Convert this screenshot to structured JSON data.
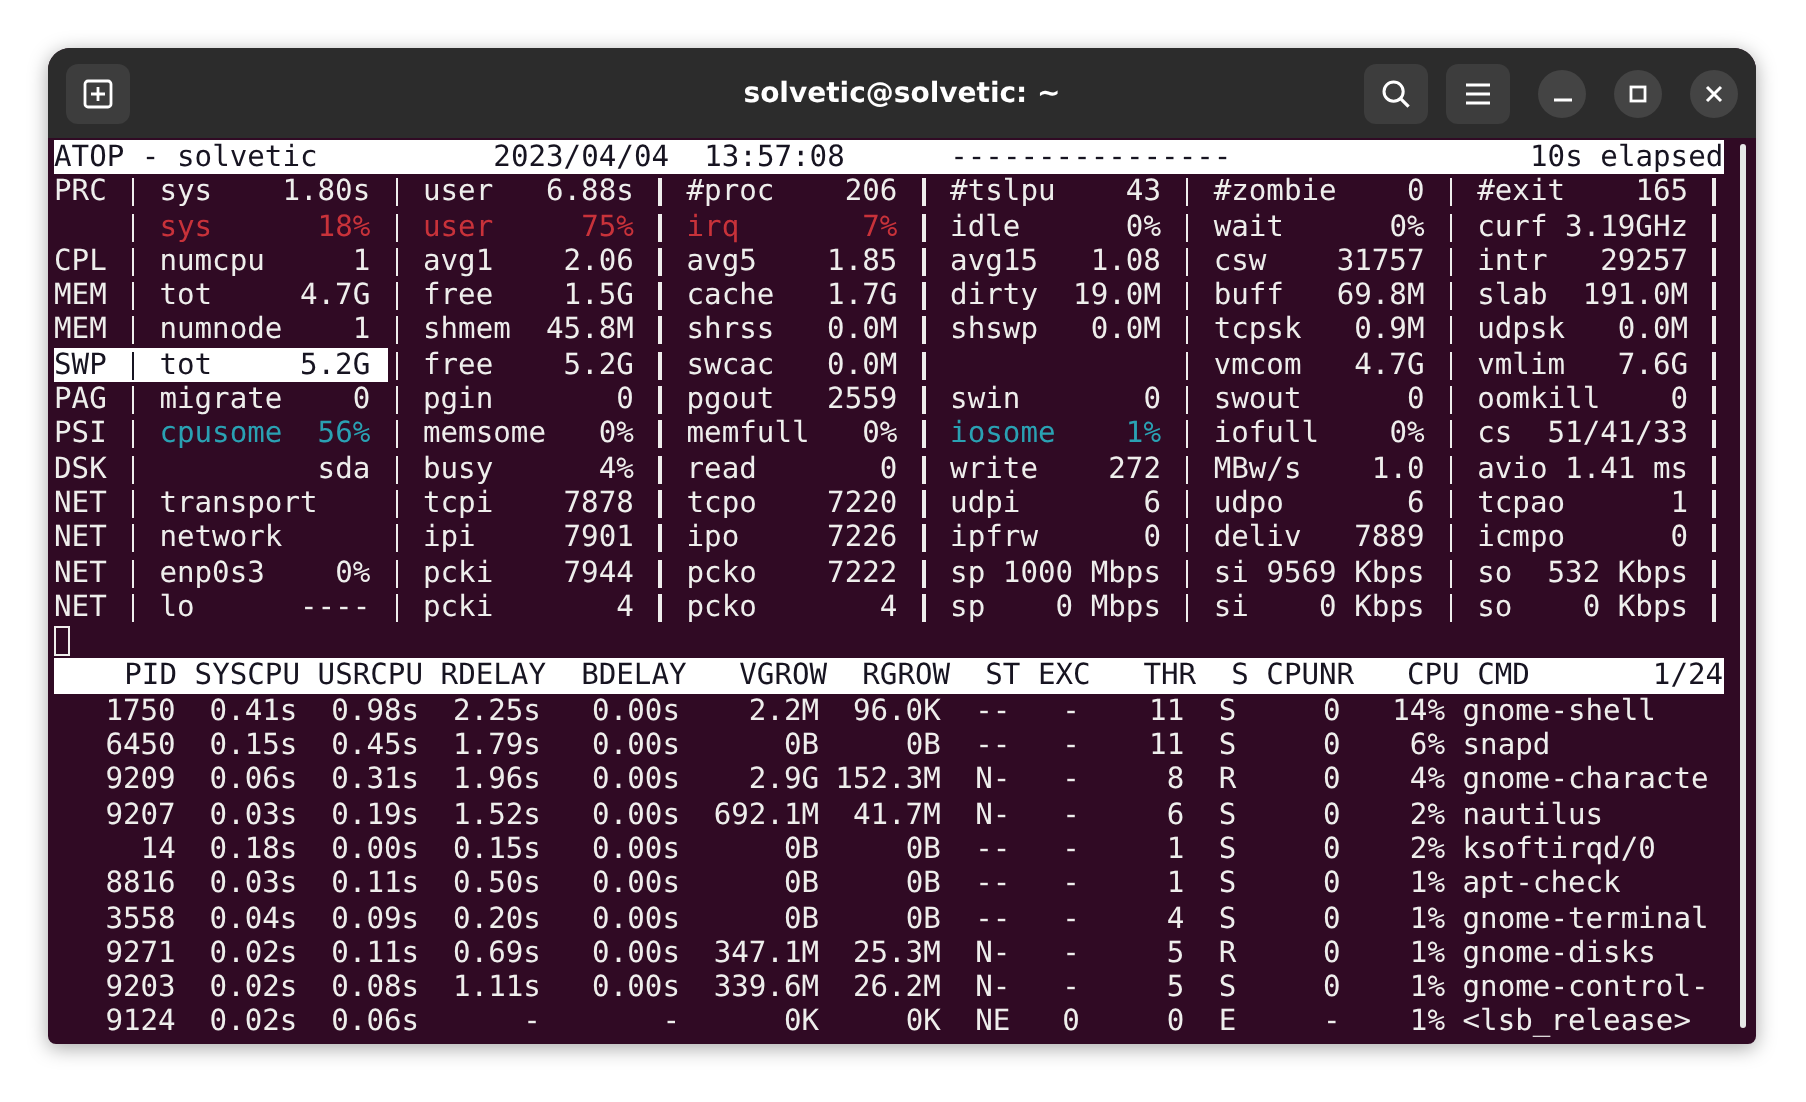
{
  "window": {
    "title": "solvetic@solvetic: ~"
  },
  "header": {
    "host": "ATOP - solvetic",
    "date": "2023/04/04",
    "time": "13:57:08",
    "dashes": "----------------",
    "elapsed": "10s elapsed"
  },
  "system_lines": [
    {
      "label": "PRC",
      "highlighted": false,
      "cells": [
        {
          "kind": "stat",
          "name": "sys",
          "value": "1.80s"
        },
        {
          "kind": "stat",
          "name": "user",
          "value": "6.88s"
        },
        {
          "kind": "stat",
          "name": "#proc",
          "value": "206"
        },
        {
          "kind": "stat",
          "name": "#tslpu",
          "value": "43"
        },
        {
          "kind": "stat",
          "name": "#zombie",
          "value": "0"
        },
        {
          "kind": "stat",
          "name": "#exit",
          "value": "165"
        }
      ]
    },
    {
      "highlighted": false,
      "cells": [
        {
          "kind": "stat",
          "name": "sys",
          "value": "18%",
          "color": "#c8323a"
        },
        {
          "kind": "stat",
          "name": "user",
          "value": "75%",
          "color": "#c8323a"
        },
        {
          "kind": "stat",
          "name": "irq",
          "value": "7%",
          "color": "#c8323a"
        },
        {
          "kind": "stat",
          "name": "idle",
          "value": "0%"
        },
        {
          "kind": "stat",
          "name": "wait",
          "value": "0%"
        },
        {
          "kind": "stat",
          "name": "curf",
          "value": "3.19GHz"
        }
      ]
    },
    {
      "label": "CPL",
      "highlighted": false,
      "cells": [
        {
          "kind": "stat",
          "name": "numcpu",
          "value": "1"
        },
        {
          "kind": "stat",
          "name": "avg1",
          "value": "2.06"
        },
        {
          "kind": "stat",
          "name": "avg5",
          "value": "1.85"
        },
        {
          "kind": "stat",
          "name": "avg15",
          "value": "1.08"
        },
        {
          "kind": "stat",
          "name": "csw",
          "value": "31757"
        },
        {
          "kind": "stat",
          "name": "intr",
          "value": "29257"
        }
      ]
    },
    {
      "label": "MEM",
      "highlighted": false,
      "cells": [
        {
          "kind": "stat",
          "name": "tot",
          "value": "4.7G"
        },
        {
          "kind": "stat",
          "name": "free",
          "value": "1.5G"
        },
        {
          "kind": "stat",
          "name": "cache",
          "value": "1.7G"
        },
        {
          "kind": "stat",
          "name": "dirty",
          "value": "19.0M"
        },
        {
          "kind": "stat",
          "name": "buff",
          "value": "69.8M"
        },
        {
          "kind": "stat",
          "name": "slab",
          "value": "191.0M"
        }
      ]
    },
    {
      "label": "MEM",
      "highlighted": false,
      "cells": [
        {
          "kind": "stat",
          "name": "numnode",
          "value": "1"
        },
        {
          "kind": "stat",
          "name": "shmem",
          "value": "45.8M"
        },
        {
          "kind": "stat",
          "name": "shrss",
          "value": "0.0M"
        },
        {
          "kind": "stat",
          "name": "shswp",
          "value": "0.0M"
        },
        {
          "kind": "stat",
          "name": "tcpsk",
          "value": "0.9M"
        },
        {
          "kind": "stat",
          "name": "udpsk",
          "value": "0.0M"
        }
      ]
    },
    {
      "label": "SWP",
      "highlighted": true,
      "cells": [
        {
          "kind": "stat",
          "name": "tot",
          "value": "5.2G"
        },
        {
          "kind": "stat",
          "name": "free",
          "value": "5.2G"
        },
        {
          "kind": "stat",
          "name": "swcac",
          "value": "0.0M"
        },
        {
          "kind": "blank"
        },
        {
          "kind": "stat",
          "name": "vmcom",
          "value": "4.7G"
        },
        {
          "kind": "stat",
          "name": "vmlim",
          "value": "7.6G"
        }
      ]
    },
    {
      "label": "PAG",
      "highlighted": false,
      "cells": [
        {
          "kind": "stat",
          "name": "migrate",
          "value": "0"
        },
        {
          "kind": "stat",
          "name": "pgin",
          "value": "0"
        },
        {
          "kind": "stat",
          "name": "pgout",
          "value": "2559"
        },
        {
          "kind": "stat",
          "name": "swin",
          "value": "0"
        },
        {
          "kind": "stat",
          "name": "swout",
          "value": "0"
        },
        {
          "kind": "stat",
          "name": "oomkill",
          "value": "0"
        }
      ]
    },
    {
      "label": "PSI",
      "highlighted": false,
      "cells": [
        {
          "kind": "stat",
          "name": "cpusome",
          "value": "56%",
          "color": "#2aa1b3"
        },
        {
          "kind": "stat",
          "name": "memsome",
          "value": "0%"
        },
        {
          "kind": "stat",
          "name": "memfull",
          "value": "0%"
        },
        {
          "kind": "stat",
          "name": "iosome",
          "value": "1%",
          "color": "#2aa1b3"
        },
        {
          "kind": "stat",
          "name": "iofull",
          "value": "0%"
        },
        {
          "kind": "stat",
          "name": "cs",
          "value": "51/41/33"
        }
      ]
    },
    {
      "label": "DSK",
      "highlighted": false,
      "cells": [
        {
          "kind": "stat",
          "value": "sda"
        },
        {
          "kind": "stat",
          "name": "busy",
          "value": "4%"
        },
        {
          "kind": "stat",
          "name": "read",
          "value": "0"
        },
        {
          "kind": "stat",
          "name": "write",
          "value": "272"
        },
        {
          "kind": "stat",
          "name": "MBw/s",
          "value": "1.0"
        },
        {
          "kind": "stat",
          "name": "avio",
          "value": "1.41 ms"
        }
      ]
    },
    {
      "label": "NET",
      "highlighted": false,
      "cells": [
        {
          "kind": "stat",
          "name": "transport"
        },
        {
          "kind": "stat",
          "name": "tcpi",
          "value": "7878"
        },
        {
          "kind": "stat",
          "name": "tcpo",
          "value": "7220"
        },
        {
          "kind": "stat",
          "name": "udpi",
          "value": "6"
        },
        {
          "kind": "stat",
          "name": "udpo",
          "value": "6"
        },
        {
          "kind": "stat",
          "name": "tcpao",
          "value": "1"
        }
      ]
    },
    {
      "label": "NET",
      "highlighted": false,
      "cells": [
        {
          "kind": "stat",
          "name": "network"
        },
        {
          "kind": "stat",
          "name": "ipi",
          "value": "7901"
        },
        {
          "kind": "stat",
          "name": "ipo",
          "value": "7226"
        },
        {
          "kind": "stat",
          "name": "ipfrw",
          "value": "0"
        },
        {
          "kind": "stat",
          "name": "deliv",
          "value": "7889"
        },
        {
          "kind": "stat",
          "name": "icmpo",
          "value": "0"
        }
      ]
    },
    {
      "label": "NET",
      "highlighted": false,
      "cells": [
        {
          "kind": "stat",
          "name": "enp0s3",
          "value": "0%"
        },
        {
          "kind": "stat",
          "name": "pcki",
          "value": "7944"
        },
        {
          "kind": "stat",
          "name": "pcko",
          "value": "7222"
        },
        {
          "kind": "stat",
          "name": "sp",
          "value": "1000 Mbps"
        },
        {
          "kind": "stat",
          "name": "si",
          "value": "9569 Kbps"
        },
        {
          "kind": "stat",
          "name": "so",
          "value": "532 Kbps"
        }
      ]
    },
    {
      "label": "NET",
      "highlighted": false,
      "cells": [
        {
          "kind": "stat",
          "name": "lo",
          "value": "----"
        },
        {
          "kind": "stat",
          "name": "pcki",
          "value": "4"
        },
        {
          "kind": "stat",
          "name": "pcko",
          "value": "4"
        },
        {
          "kind": "stat",
          "name": "sp",
          "value": "0 Mbps"
        },
        {
          "kind": "stat",
          "name": "si",
          "value": "0 Kbps"
        },
        {
          "kind": "stat",
          "name": "so",
          "value": "0 Kbps"
        }
      ]
    }
  ],
  "process_table": {
    "columns": [
      "PID",
      "SYSCPU",
      "USRCPU",
      "RDELAY",
      "BDELAY",
      "VGROW",
      "RGROW",
      "ST",
      "EXC",
      "THR",
      "S",
      "CPUNR",
      "CPU",
      "CMD"
    ],
    "page": "1/24",
    "rows": [
      [
        "1750",
        "0.41s",
        "0.98s",
        "2.25s",
        "0.00s",
        "2.2M",
        "96.0K",
        "--",
        "-",
        "11",
        "S",
        "0",
        "14%",
        "gnome-shell"
      ],
      [
        "6450",
        "0.15s",
        "0.45s",
        "1.79s",
        "0.00s",
        "0B",
        "0B",
        "--",
        "-",
        "11",
        "S",
        "0",
        "6%",
        "snapd"
      ],
      [
        "9209",
        "0.06s",
        "0.31s",
        "1.96s",
        "0.00s",
        "2.9G",
        "152.3M",
        "N-",
        "-",
        "8",
        "R",
        "0",
        "4%",
        "gnome-characte"
      ],
      [
        "9207",
        "0.03s",
        "0.19s",
        "1.52s",
        "0.00s",
        "692.1M",
        "41.7M",
        "N-",
        "-",
        "6",
        "S",
        "0",
        "2%",
        "nautilus"
      ],
      [
        "14",
        "0.18s",
        "0.00s",
        "0.15s",
        "0.00s",
        "0B",
        "0B",
        "--",
        "-",
        "1",
        "S",
        "0",
        "2%",
        "ksoftirqd/0"
      ],
      [
        "8816",
        "0.03s",
        "0.11s",
        "0.50s",
        "0.00s",
        "0B",
        "0B",
        "--",
        "-",
        "1",
        "S",
        "0",
        "1%",
        "apt-check"
      ],
      [
        "3558",
        "0.04s",
        "0.09s",
        "0.20s",
        "0.00s",
        "0B",
        "0B",
        "--",
        "-",
        "4",
        "S",
        "0",
        "1%",
        "gnome-terminal"
      ],
      [
        "9271",
        "0.02s",
        "0.11s",
        "0.69s",
        "0.00s",
        "347.1M",
        "25.3M",
        "N-",
        "-",
        "5",
        "R",
        "0",
        "1%",
        "gnome-disks"
      ],
      [
        "9203",
        "0.02s",
        "0.08s",
        "1.11s",
        "0.00s",
        "339.6M",
        "26.2M",
        "N-",
        "-",
        "5",
        "S",
        "0",
        "1%",
        "gnome-control-"
      ],
      [
        "9124",
        "0.02s",
        "0.06s",
        "-",
        "-",
        "0K",
        "0K",
        "NE",
        "0",
        "0",
        "E",
        "-",
        "1%",
        "<lsb_release>"
      ]
    ]
  }
}
